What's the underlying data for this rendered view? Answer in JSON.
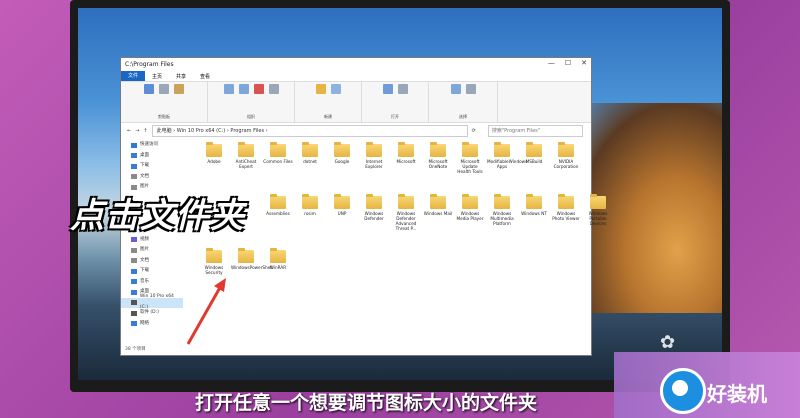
{
  "window": {
    "title": "C:\\Program Files",
    "controls": [
      "—",
      "☐",
      "✕"
    ]
  },
  "ribbon_tabs": [
    "文件",
    "主页",
    "共享",
    "查看"
  ],
  "ribbon_groups": [
    "剪贴板",
    "组织",
    "新建",
    "打开",
    "选择"
  ],
  "address": {
    "path": "此电脑  ›  Win 10 Pro x64 (C:)  ›  Program Files  ›",
    "search_placeholder": "搜索\"Program Files\""
  },
  "nav": {
    "items": [
      {
        "label": "快速访问",
        "color": "#2b7bd8"
      },
      {
        "label": "桌面",
        "color": "#3a7bd5"
      },
      {
        "label": "下载",
        "color": "#3a7bd5"
      },
      {
        "label": "文档",
        "color": "#8a8a8a"
      },
      {
        "label": "图片",
        "color": "#8a8a8a"
      },
      {
        "label": "",
        "color": ""
      },
      {
        "label": "",
        "color": ""
      },
      {
        "label": "",
        "color": ""
      },
      {
        "label": "3D 对象",
        "color": "#3a7bd5"
      },
      {
        "label": "视频",
        "color": "#6b5bd5"
      },
      {
        "label": "图片",
        "color": "#8a8a8a"
      },
      {
        "label": "文档",
        "color": "#8a8a8a"
      },
      {
        "label": "下载",
        "color": "#3a7bd5"
      },
      {
        "label": "音乐",
        "color": "#3a7bd5"
      },
      {
        "label": "桌面",
        "color": "#3a7bd5"
      },
      {
        "label": "Win 10 Pro x64 (C:)",
        "color": "#555",
        "selected": true
      },
      {
        "label": "软件 (D:)",
        "color": "#555"
      },
      {
        "label": "网络",
        "color": "#3a7bd5"
      }
    ]
  },
  "folders_row1": [
    "Adobe",
    "AntiCheat Expert",
    "Common Files",
    "dotnet",
    "Google",
    "Internet Explorer",
    "Microsoft",
    "Microsoft OneNote",
    "Microsoft Update Health Tools",
    "ModifiableWindows Apps",
    "MSBuild",
    "NVIDIA Corporation"
  ],
  "folders_row2": [
    "",
    "",
    "Assemblies",
    "rosim",
    "UNP",
    "Windows Defender",
    "Windows Defender Advanced Threat P...",
    "Windows Mail",
    "Windows Media Player",
    "Windows Multimedia Platform",
    "Windows NT",
    "Windows Photo Viewer",
    "Windows Portable Devices"
  ],
  "folders_row3": [
    "Windows Security",
    "WindowsPowerShell",
    "WinRAR"
  ],
  "status_text": "38 个项目",
  "overlay_text": "点击文件夹",
  "subtitle_text": "打开任意一个想要调节图标大小的文件夹",
  "logo_text": "好装机",
  "colors": {
    "accent": "#1a66c4",
    "folder": "#e6b443",
    "overlay_stroke": "#000000"
  }
}
